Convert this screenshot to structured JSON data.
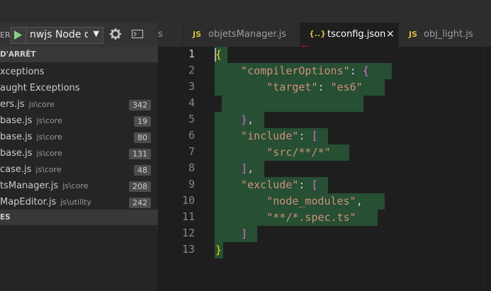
{
  "debug": {
    "label_fragment": "ER",
    "config_value": "nwjs Node de",
    "play_icon": "play-icon",
    "gear_icon": "gear-icon",
    "console_icon": "console-icon"
  },
  "tabs": [
    {
      "ext": "",
      "label": "s"
    },
    {
      "ext": "JS",
      "label": "objetsManager.js"
    },
    {
      "ext": "{..}",
      "label": "tsconfig.json",
      "close": "×",
      "active": true
    },
    {
      "ext": "JS",
      "label": "obj_light.js"
    }
  ],
  "sidebar": {
    "breakpoints_header": "D'ARRÊT",
    "exceptions": [
      "xceptions",
      "aught Exceptions"
    ],
    "files": [
      {
        "name": "ers.js",
        "path": "js\\core",
        "count": "342"
      },
      {
        "name": "base.js",
        "path": "js\\core",
        "count": "19"
      },
      {
        "name": "base.js",
        "path": "js\\core",
        "count": "80"
      },
      {
        "name": "base.js",
        "path": "js\\core",
        "count": "131"
      },
      {
        "name": "case.js",
        "path": "js\\core",
        "count": "48"
      },
      {
        "name": "tsManager.js",
        "path": "js\\core",
        "count": "208"
      },
      {
        "name": "MapEditor.js",
        "path": "js\\utility",
        "count": "242"
      }
    ],
    "second_header": "ES"
  },
  "editor": {
    "line_numbers": [
      "1",
      "2",
      "3",
      "4",
      "5",
      "6",
      "7",
      "8",
      "9",
      "10",
      "11",
      "12",
      "13"
    ],
    "code": {
      "l1": "{",
      "l2_key": "\"compilerOptions\"",
      "l2_colon": ": ",
      "l2_brace": "{",
      "l3_key": "\"target\"",
      "l3_colon": ": ",
      "l3_val": "\"es6\"",
      "l5_brace": "}",
      "l5_comma": ",",
      "l6_key": "\"include\"",
      "l6_colon": ": ",
      "l6_bracket": "[",
      "l7_val": "\"src/**/*\"",
      "l8_bracket": "]",
      "l8_comma": ",",
      "l9_key": "\"exclude\"",
      "l9_colon": ": ",
      "l9_bracket": "[",
      "l10_val": "\"node_modules\"",
      "l10_comma": ",",
      "l11_val": "\"**/*.spec.ts\"",
      "l12_bracket": "]",
      "l13": "}"
    }
  },
  "colors": {
    "selection": "#264f34",
    "annotation": "#e3152e",
    "json_icon": "#d6bb3d"
  }
}
